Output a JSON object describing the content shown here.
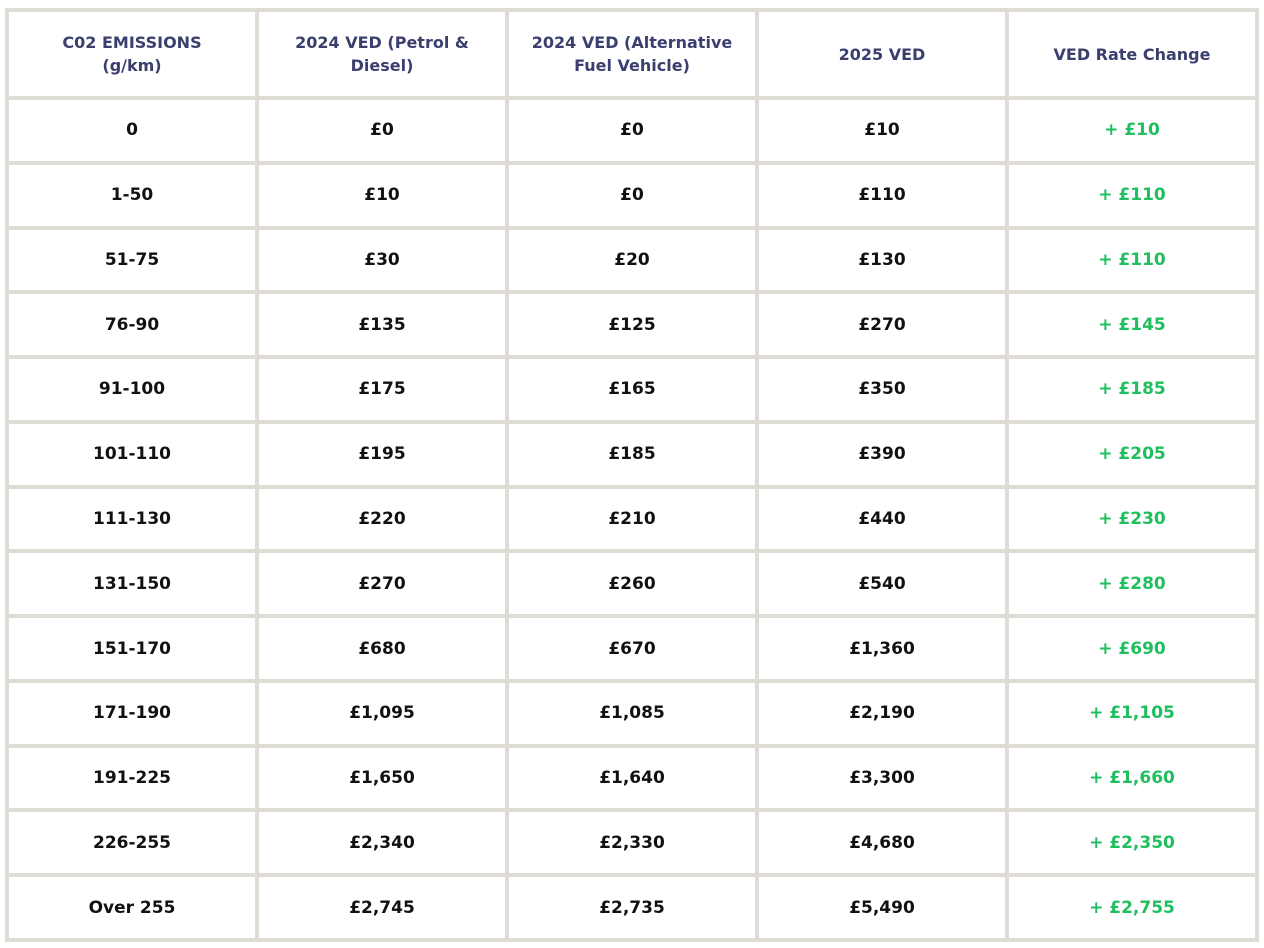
{
  "table": {
    "headers": [
      "C02 EMISSIONS\n(g/km)",
      "2024 VED (Petrol &\nDiesel)",
      "2024 VED (Alternative\nFuel Vehicle)",
      "2025 VED",
      "VED Rate Change"
    ],
    "rows": [
      [
        "0",
        "£0",
        "£0",
        "£10",
        "+ £10"
      ],
      [
        "1-50",
        "£10",
        "£0",
        "£110",
        "+ £110"
      ],
      [
        "51-75",
        "£30",
        "£20",
        "£130",
        "+ £110"
      ],
      [
        "76-90",
        "£135",
        "£125",
        "£270",
        "+ £145"
      ],
      [
        "91-100",
        "£175",
        "£165",
        "£350",
        "+ £185"
      ],
      [
        "101-110",
        "£195",
        "£185",
        "£390",
        "+ £205"
      ],
      [
        "111-130",
        "£220",
        "£210",
        "£440",
        "+ £230"
      ],
      [
        "131-150",
        "£270",
        "£260",
        "£540",
        "+ £280"
      ],
      [
        "151-170",
        "£680",
        "£670",
        "£1,360",
        "+ £690"
      ],
      [
        "171-190",
        "£1,095",
        "£1,085",
        "£2,190",
        "+ £1,105"
      ],
      [
        "191-225",
        "£1,650",
        "£1,640",
        "£3,300",
        "+ £1,660"
      ],
      [
        "226-255",
        "£2,340",
        "£2,330",
        "£4,680",
        "+ £2,350"
      ],
      [
        "Over 255",
        "£2,745",
        "£2,735",
        "£5,490",
        "+ £2,755"
      ]
    ]
  },
  "colors": {
    "header_text": "#3a3f6e",
    "body_text": "#111111",
    "change_text": "#1fbf5f",
    "grid": "#dfdcd6",
    "cell_background": "#ffffff"
  }
}
